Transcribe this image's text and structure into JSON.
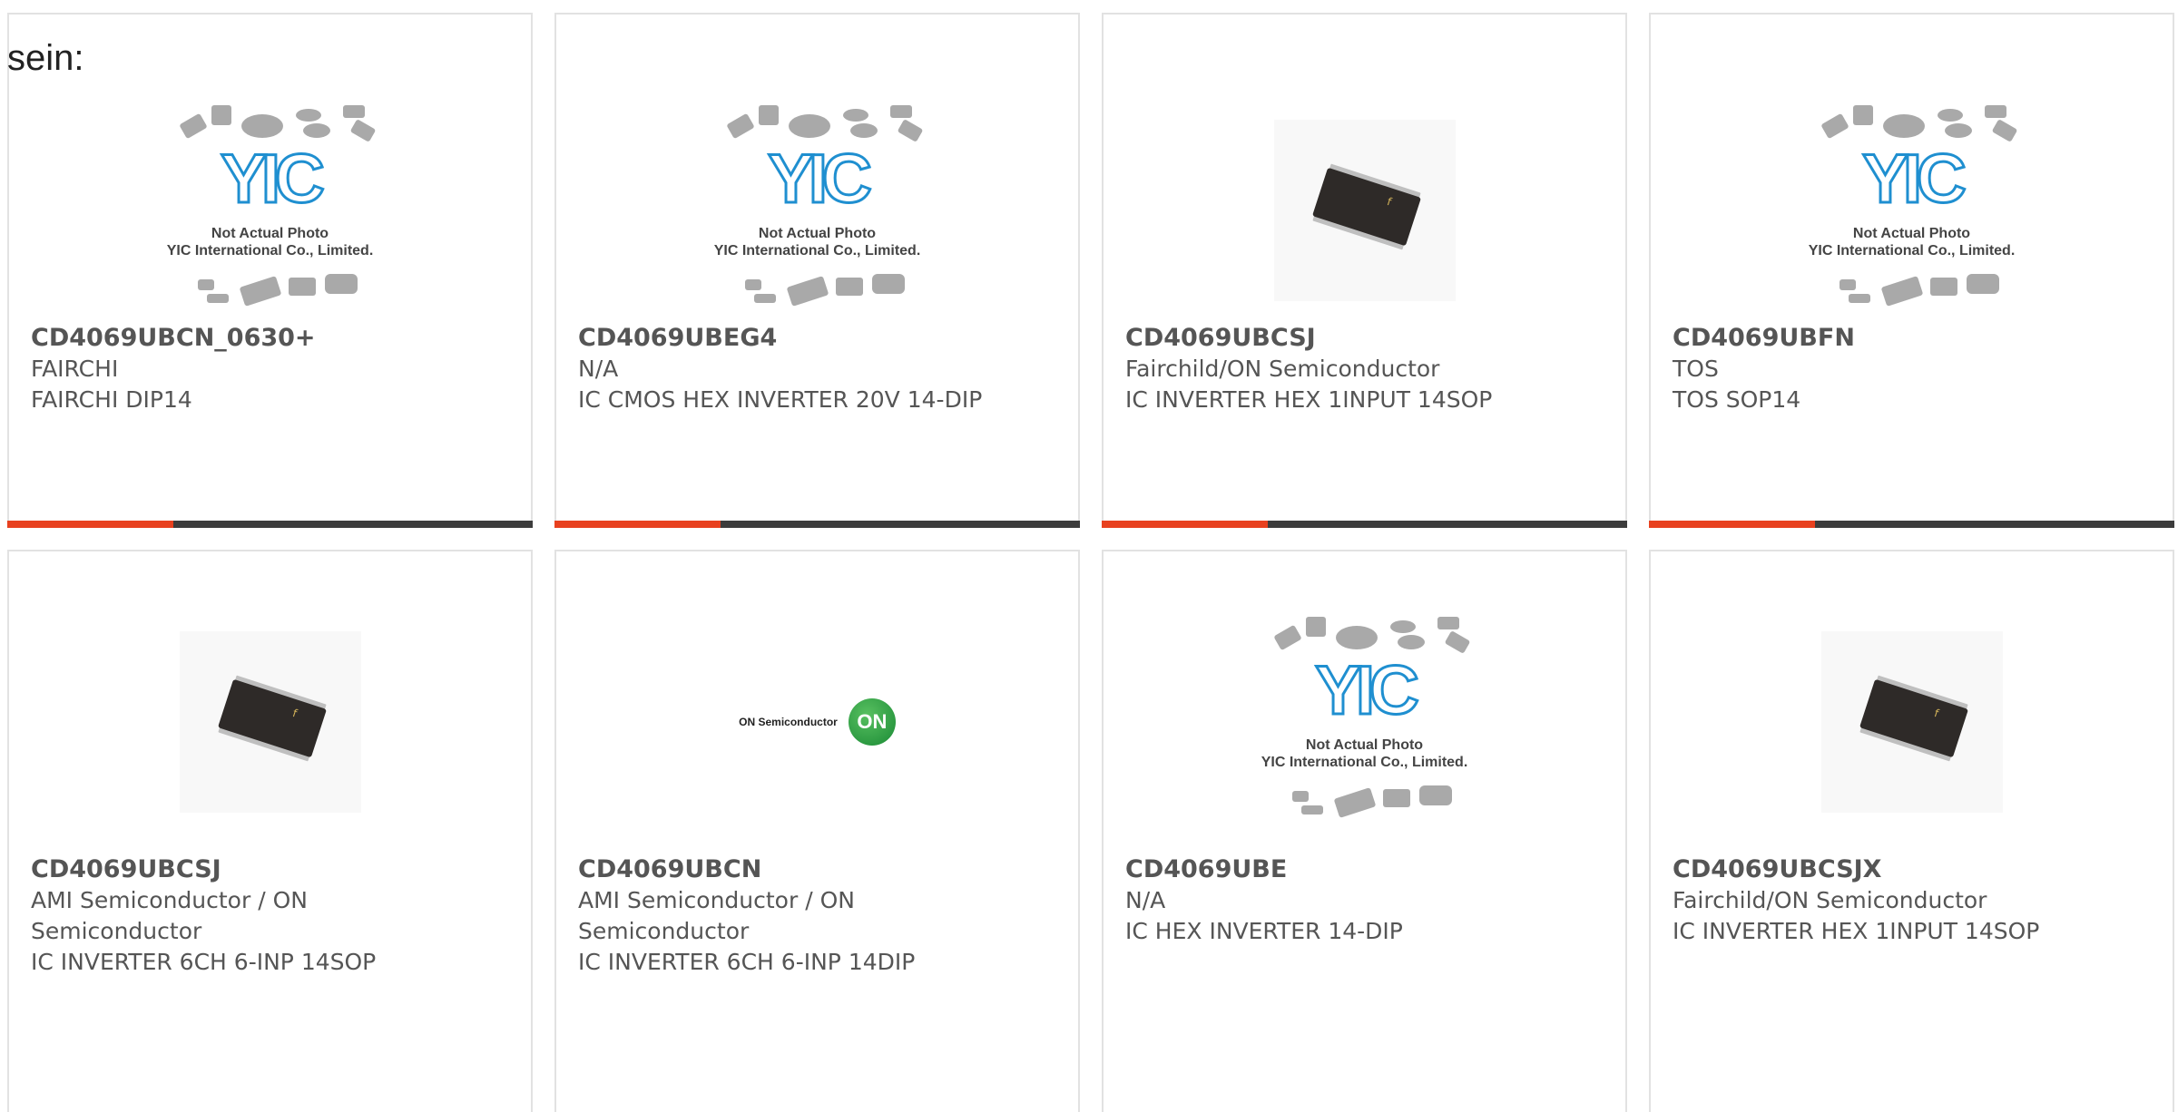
{
  "intro_text": "sein:",
  "placeholder": {
    "caption_line1": "Not Actual Photo",
    "caption_line2": "YIC International Co., Limited."
  },
  "onsemi_text": "ON Semiconductor",
  "onsemi_mark": "ON",
  "products": [
    {
      "part": "CD4069UBCN_0630+",
      "manufacturer": "FAIRCHI",
      "description": "FAIRCHI DIP14",
      "image": "placeholder"
    },
    {
      "part": "CD4069UBEG4",
      "manufacturer": "N/A",
      "description": "IC CMOS HEX INVERTER 20V 14-DIP",
      "image": "placeholder"
    },
    {
      "part": "CD4069UBCSJ",
      "manufacturer": "Fairchild/ON Semiconductor",
      "description": "IC INVERTER HEX 1INPUT 14SOP",
      "image": "soic-chip"
    },
    {
      "part": "CD4069UBFN",
      "manufacturer": "TOS",
      "description": "TOS SOP14",
      "image": "placeholder"
    },
    {
      "part": "CD4069UBCSJ",
      "manufacturer": "AMI Semiconductor / ON Semiconductor",
      "description": "IC INVERTER 6CH 6-INP 14SOP",
      "image": "soic-chip"
    },
    {
      "part": "CD4069UBCN",
      "manufacturer": "AMI Semiconductor / ON Semiconductor",
      "description": "IC INVERTER 6CH 6-INP 14DIP",
      "image": "onsemi-logo"
    },
    {
      "part": "CD4069UBE",
      "manufacturer": "N/A",
      "description": "IC HEX INVERTER 14-DIP",
      "image": "placeholder"
    },
    {
      "part": "CD4069UBCSJX",
      "manufacturer": "Fairchild/ON Semiconductor",
      "description": "IC INVERTER HEX 1INPUT 14SOP",
      "image": "soic-chip"
    }
  ],
  "colors": {
    "accent": "#e8411f",
    "bar": "#3c3c3c",
    "border": "#e2e2e2",
    "text": "#555555"
  }
}
